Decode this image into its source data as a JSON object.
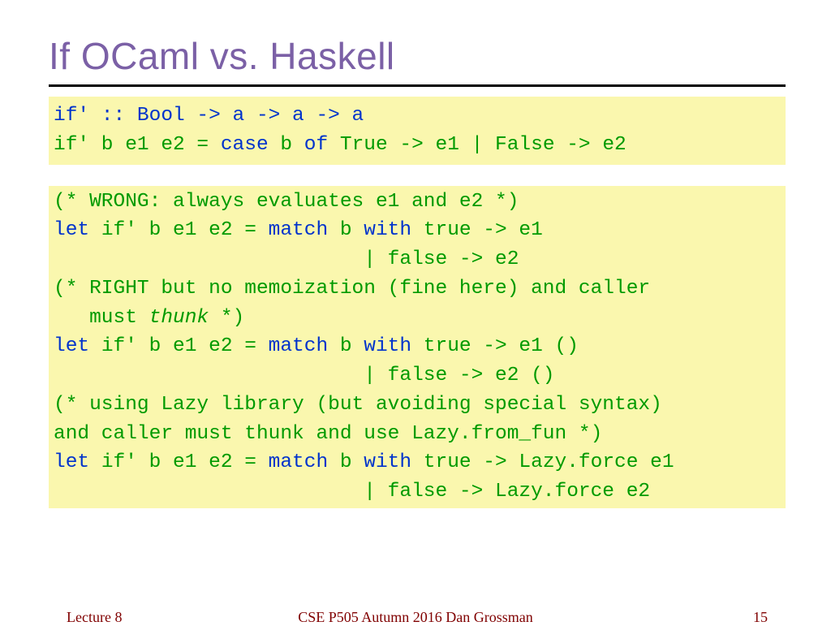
{
  "title": "If OCaml vs. Haskell",
  "box1": {
    "l1a": "if' :: Bool -> a -> a -> a",
    "l2a": "if' b e1 e2 = ",
    "l2b": "case ",
    "l2c": "b ",
    "l2d": "of ",
    "l2e": "True -> e1 | False -> e2"
  },
  "box2": {
    "l1": "(* WRONG: always evaluates e1 and e2 *)",
    "l2a": "let ",
    "l2b": "if' b e1 e2 = ",
    "l2c": "match ",
    "l2d": "b ",
    "l2e": "with ",
    "l2f": "true -> e1",
    "l3a": "                          | false -> e2",
    "l4a": "(* RIGHT but no memoization (fine here) and caller",
    "l5a": "   must ",
    "l5b": "thunk",
    "l5c": " *)",
    "l6a": "let ",
    "l6b": "if' b e1 e2 = ",
    "l6c": "match ",
    "l6d": "b ",
    "l6e": "with ",
    "l6f": "true -> e1 ()",
    "l7a": "                          | false -> e2 ()",
    "l8a": "(* using Lazy library (but avoiding special syntax)",
    "l9a": "and caller must thunk and use Lazy.from_fun *)",
    "l10a": "let ",
    "l10b": "if' b e1 e2 = ",
    "l10c": "match ",
    "l10d": "b ",
    "l10e": "with ",
    "l10f": "true -> Lazy.force e1",
    "l11a": "                          | false -> Lazy.force e2"
  },
  "footer": {
    "left": "Lecture 8",
    "center": "CSE P505 Autumn 2016  Dan Grossman",
    "right": "15"
  }
}
